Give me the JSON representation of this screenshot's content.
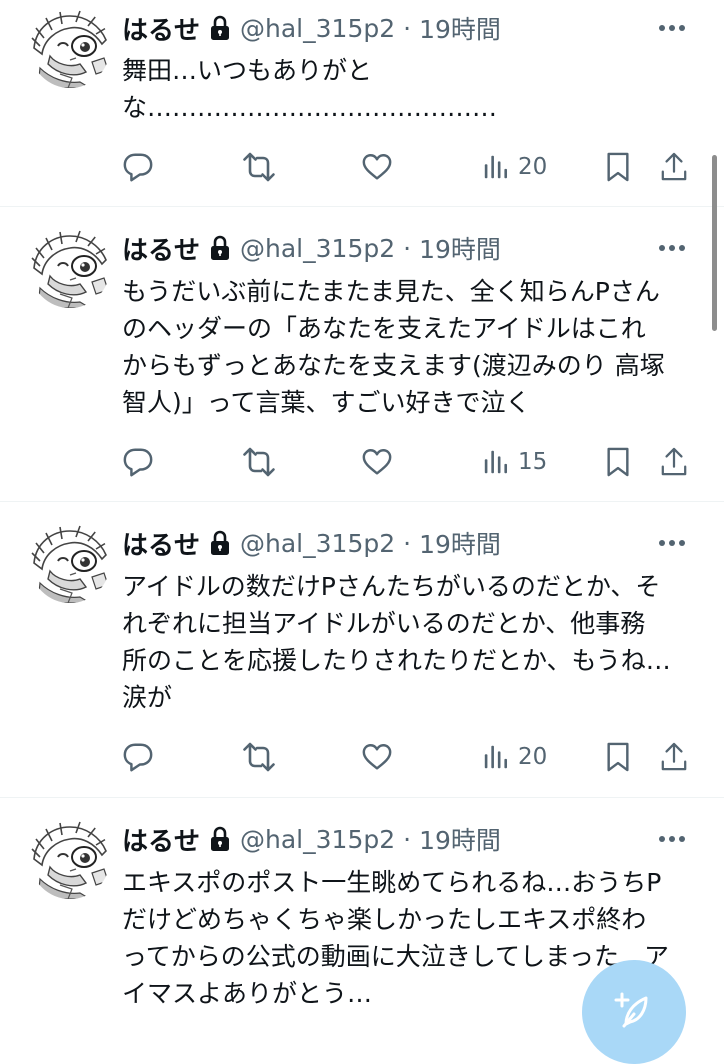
{
  "tweets": [
    {
      "display_name": "はるせ",
      "handle": "@hal_315p2",
      "separator": "·",
      "time": "19時間",
      "text": "舞田…いつもありがと\nな……………………………………",
      "views": "20"
    },
    {
      "display_name": "はるせ",
      "handle": "@hal_315p2",
      "separator": "·",
      "time": "19時間",
      "text": "もうだいぶ前にたまたま見た、全く知らんPさん\nのヘッダーの「あなたを支えたアイドルはこれ\nからもずっとあなたを支えます(渡辺みのり 高塚\n智人)」って言葉、すごい好きで泣く",
      "views": "15"
    },
    {
      "display_name": "はるせ",
      "handle": "@hal_315p2",
      "separator": "·",
      "time": "19時間",
      "text": "アイドルの数だけPさんたちがいるのだとか、そ\nれぞれに担当アイドルがいるのだとか、他事務\n所のことを応援したりされたりだとか、もうね…\n涙が",
      "views": "20"
    },
    {
      "display_name": "はるせ",
      "handle": "@hal_315p2",
      "separator": "·",
      "time": "19時間",
      "text": "エキスポのポスト一生眺めてられるね…おうちP\nだけどめちゃくちゃ楽しかったしエキスポ終わ\nってからの公式の動画に大泣きしてしまった…ア\nイマスよありがとう…"
    }
  ],
  "icons": {
    "reply": "reply-icon",
    "repost": "repost-icon",
    "like": "like-icon",
    "views": "views-icon",
    "bookmark": "bookmark-icon",
    "share": "share-icon",
    "more": "more-icon",
    "lock": "lock-icon",
    "compose": "compose-icon"
  },
  "colors": {
    "text_primary": "#0f1419",
    "text_secondary": "#536471",
    "divider": "#eff3f4",
    "fab": "#a9d8f7"
  }
}
